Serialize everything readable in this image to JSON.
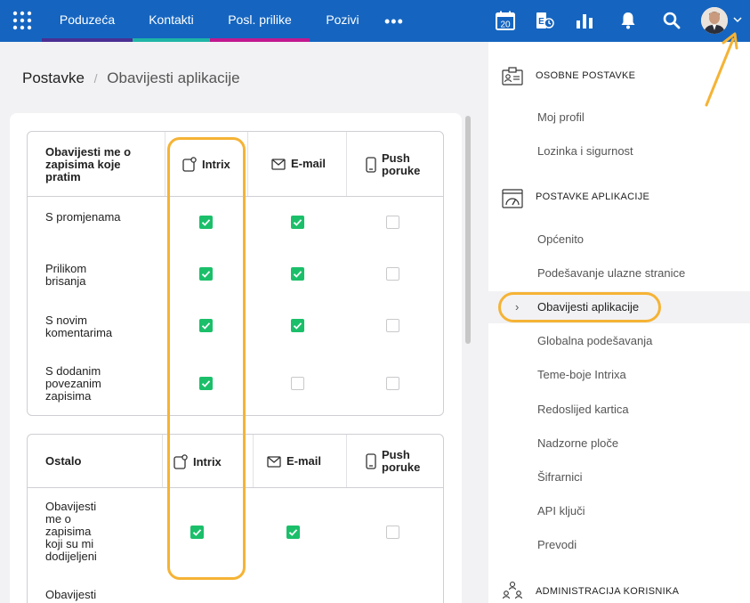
{
  "nav": {
    "items": [
      {
        "label": "Poduzeća",
        "accent": "#4a2f93"
      },
      {
        "label": "Kontakti",
        "accent": "#1fb5a6"
      },
      {
        "label": "Posl. prilike",
        "accent": "#c2188f"
      },
      {
        "label": "Pozivi",
        "accent": ""
      }
    ],
    "more_label": "•••",
    "calendar_day": "20",
    "brand_color": "#1565c0"
  },
  "breadcrumb": {
    "root": "Postavke",
    "separator": "/",
    "current": "Obavijesti aplikacije"
  },
  "section1": {
    "title": "Obavijesti me o zapisima koje pratim",
    "columns": [
      "Intrix",
      "E-mail",
      "Push poruke"
    ],
    "rows": [
      {
        "label": "S promjenama",
        "values": [
          true,
          true,
          false
        ]
      },
      {
        "label": "Prilikom brisanja",
        "values": [
          true,
          true,
          false
        ]
      },
      {
        "label": "S novim komentarima",
        "values": [
          true,
          true,
          false
        ]
      },
      {
        "label": "S dodanim povezanim zapisima",
        "values": [
          true,
          false,
          false
        ]
      }
    ]
  },
  "section2": {
    "title": "Ostalo",
    "columns": [
      "Intrix",
      "E-mail",
      "Push poruke"
    ],
    "rows": [
      {
        "label": "Obavijesti me o zapisima koji su mi dodijeljeni",
        "values": [
          true,
          true,
          false
        ]
      },
      {
        "label": "Obavijesti",
        "values": []
      }
    ]
  },
  "sidebar": {
    "personal_title": "OSOBNE POSTAVKE",
    "personal_items": [
      "Moj profil",
      "Lozinka i sigurnost"
    ],
    "app_title": "POSTAVKE APLIKACIJE",
    "app_items": [
      "Općenito",
      "Podešavanje ulazne stranice",
      "Obavijesti aplikacije",
      "Globalna podešavanja",
      "Teme-boje Intrixa",
      "Redoslijed kartica",
      "Nadzorne ploče",
      "Šifrarnici",
      "API ključi",
      "Prevodi"
    ],
    "active_item": "Obavijesti aplikacije",
    "admin_title": "ADMINISTRACIJA KORISNIKA"
  },
  "highlight_color": "#f5b335",
  "check_color": "#1bbf6a"
}
